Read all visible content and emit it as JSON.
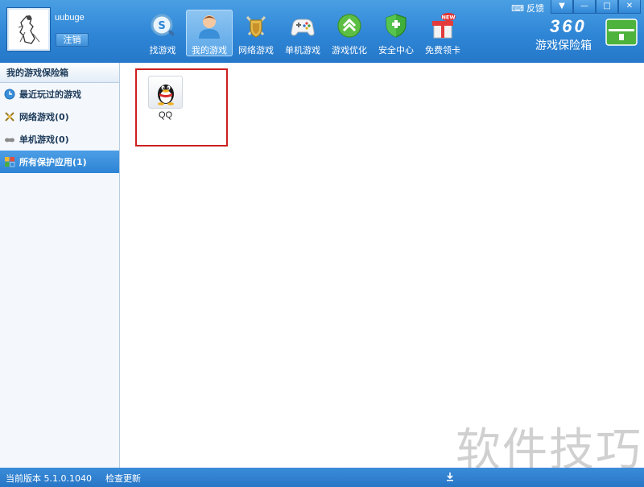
{
  "user": {
    "name": "uubuge",
    "logout_label": "注销"
  },
  "nav": [
    {
      "label": "找游戏",
      "icon": "search-game-icon"
    },
    {
      "label": "我的游戏",
      "icon": "user-icon",
      "active": true
    },
    {
      "label": "网络游戏",
      "icon": "swords-shield-icon"
    },
    {
      "label": "单机游戏",
      "icon": "gamepad-icon"
    },
    {
      "label": "游戏优化",
      "icon": "arrow-up-icon"
    },
    {
      "label": "安全中心",
      "icon": "shield-check-icon"
    },
    {
      "label": "免费领卡",
      "icon": "gift-icon",
      "badge": "NEW"
    }
  ],
  "window": {
    "feedback_label": "反馈",
    "minimize": "—",
    "maximize": "□",
    "close": "✕"
  },
  "brand": {
    "number": "360",
    "name": "游戏保险箱"
  },
  "sidebar": {
    "title": "我的游戏保险箱",
    "items": [
      {
        "label": "最近玩过的游戏",
        "icon": "clock-icon"
      },
      {
        "label": "网络游戏(0)",
        "icon": "swords-icon"
      },
      {
        "label": "单机游戏(0)",
        "icon": "gamepad-icon"
      },
      {
        "label": "所有保护应用(1)",
        "icon": "apps-icon",
        "active": true
      }
    ]
  },
  "apps": [
    {
      "label": "QQ",
      "icon": "qq-penguin-icon"
    }
  ],
  "footer": {
    "version": "当前版本 5.1.0.1040",
    "check_update": "检查更新"
  },
  "watermark": "软件技巧",
  "colors": {
    "header": "#2f86d6",
    "selection": "#cc1f1f",
    "active_item": "#3a8fdb"
  }
}
